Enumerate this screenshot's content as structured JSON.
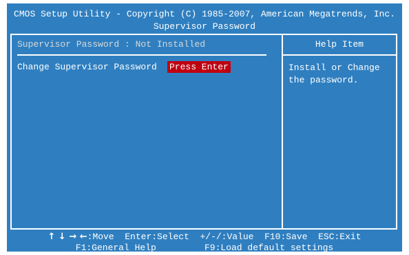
{
  "header": {
    "line1": "CMOS Setup Utility - Copyright (C) 1985-2007, American Megatrends, Inc.",
    "line2": "Supervisor Password"
  },
  "status": {
    "text": "Supervisor Password : Not Installed"
  },
  "items": [
    {
      "label": "Change Supervisor Password",
      "value": "Press Enter"
    }
  ],
  "help": {
    "title": "Help Item",
    "text": "Install or Change the password."
  },
  "footer": {
    "arrows": "↑ ↓ → ←",
    "line1_rest": ":Move  Enter:Select  +/-/:Value  F10:Save  ESC:Exit",
    "line2": "F1:General Help         F9:Load default settings"
  },
  "colors": {
    "background": "#2f7fc0",
    "highlight": "#c00010",
    "text": "#ffffff"
  }
}
